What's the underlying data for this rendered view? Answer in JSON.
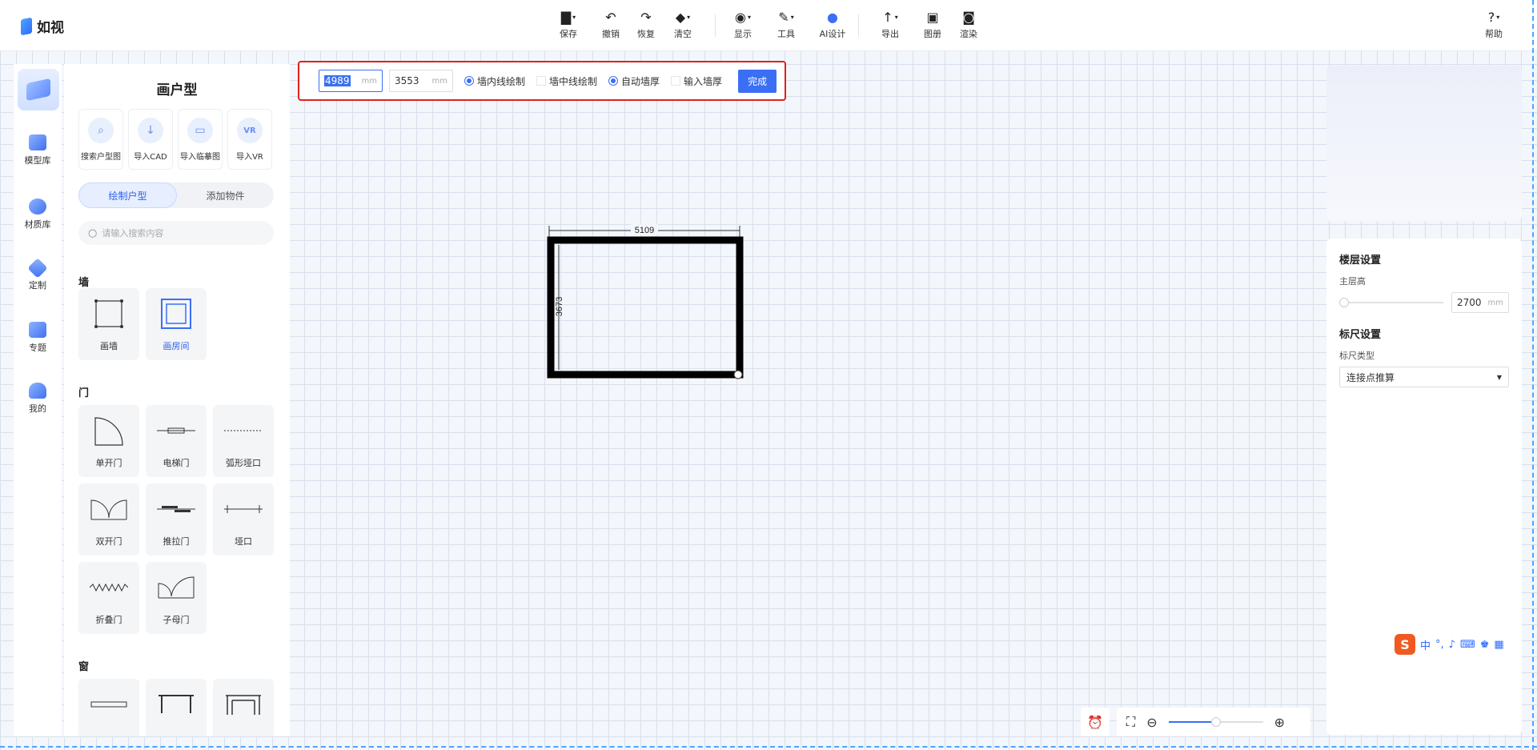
{
  "app": {
    "name": "如视"
  },
  "toolbar": {
    "save": "保存",
    "undo": "撤销",
    "redo": "恢复",
    "clear": "清空",
    "display": "显示",
    "tools": "工具",
    "ai_design": "AI设计",
    "export": "导出",
    "atlas": "图册",
    "render": "渲染",
    "help": "帮助"
  },
  "drawbar": {
    "length_value": "4989",
    "width_value": "3553",
    "unit": "mm",
    "option_inner": "墙内线绘制",
    "option_center": "墙中线绘制",
    "option_auto_thickness": "自动墙厚",
    "option_input_thickness": "输入墙厚",
    "inner_checked": true,
    "center_checked": false,
    "auto_checked": true,
    "input_checked": false,
    "done_label": "完成"
  },
  "nav": {
    "items": [
      "模型库",
      "材质库",
      "定制",
      "专题",
      "我的"
    ]
  },
  "panel": {
    "title": "画户型",
    "imports": [
      "搜索户型图",
      "导入CAD",
      "导入临摹图",
      "导入VR"
    ],
    "tabs": [
      "绘制户型",
      "添加物件"
    ],
    "active_tab": "绘制户型",
    "search_placeholder": "请输入搜索内容",
    "sections": {
      "wall": {
        "title": "墙",
        "items": [
          "画墙",
          "画房间"
        ],
        "active": "画房间"
      },
      "door": {
        "title": "门",
        "items": [
          "单开门",
          "电梯门",
          "弧形垭口",
          "双开门",
          "推拉门",
          "垭口",
          "折叠门",
          "子母门"
        ]
      },
      "window": {
        "title": "窗"
      }
    }
  },
  "canvas": {
    "room_width_label": "5109",
    "room_height_label": "3673"
  },
  "right_panel": {
    "floor_settings_title": "楼层设置",
    "floor_height_label": "主层高",
    "floor_height_value": "2700",
    "floor_height_unit": "mm",
    "ruler_settings_title": "标尺设置",
    "ruler_type_label": "标尺类型",
    "ruler_type_value": "连接点推算"
  },
  "ime": {
    "lang": "中"
  },
  "zoom": {
    "level_fraction": 0.5
  },
  "colors": {
    "accent": "#3a6ff5",
    "highlight_border": "#e0201c",
    "ime_brand": "#f05a22"
  }
}
